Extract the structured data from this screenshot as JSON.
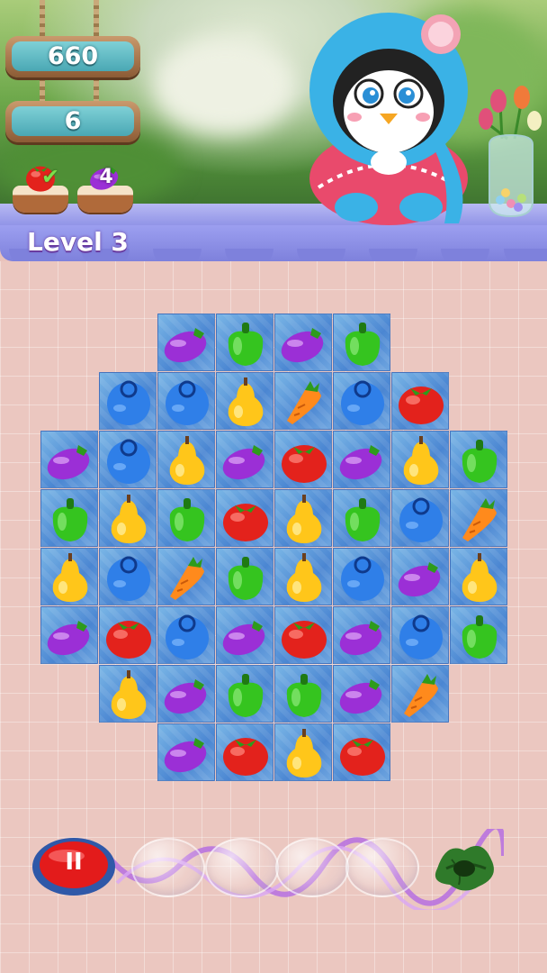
{
  "hud": {
    "score": "660",
    "moves": "6"
  },
  "goals": [
    {
      "item": "tomato-icon",
      "status": "done"
    },
    {
      "item": "eggplant-icon",
      "count": "4"
    }
  ],
  "level_label": "Level 3",
  "board": {
    "columns": 8,
    "rows": [
      [
        null,
        null,
        "eggplant",
        "pepper",
        "eggplant",
        "pepper",
        null,
        null
      ],
      [
        null,
        "blueberry",
        "blueberry",
        "pear",
        "carrot",
        "blueberry",
        "tomato",
        null
      ],
      [
        "eggplant",
        "blueberry",
        "pear",
        "eggplant",
        "tomato",
        "eggplant",
        "pear",
        "pepper"
      ],
      [
        "pepper",
        "pear",
        "pepper",
        "tomato",
        "pear",
        "pepper",
        "blueberry",
        "carrot"
      ],
      [
        "pear",
        "blueberry",
        "carrot",
        "pepper",
        "pear",
        "blueberry",
        "eggplant",
        "pear"
      ],
      [
        "eggplant",
        "tomato",
        "blueberry",
        "eggplant",
        "tomato",
        "eggplant",
        "blueberry",
        "pepper"
      ],
      [
        null,
        "pear",
        "eggplant",
        "pepper",
        "pepper",
        "eggplant",
        "carrot",
        null
      ],
      [
        null,
        null,
        "eggplant",
        "tomato",
        "pear",
        "tomato",
        null,
        null
      ]
    ]
  },
  "colors": {
    "eggplant": "#9b2fd6",
    "pepper": "#35c41f",
    "blueberry": "#2f7fe8",
    "pear": "#ffc61a",
    "carrot": "#ff8a1c",
    "tomato": "#e3221c",
    "shelf": "#9c9ff0",
    "floor": "#ebc7c0"
  },
  "pause_button": {
    "icon": "pause-icon",
    "label": "II"
  },
  "booster_progress": {
    "slots": 5,
    "filled": 0,
    "reward_icon": "leaf-icon"
  }
}
